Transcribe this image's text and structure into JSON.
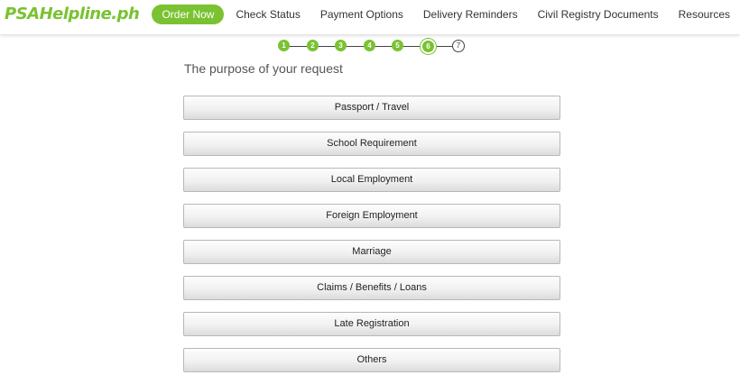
{
  "brand": {
    "logo_text": "PSAHelpline.ph",
    "accent_color": "#7ac231"
  },
  "nav": {
    "items": [
      {
        "label": "Order Now",
        "primary": true
      },
      {
        "label": "Check Status"
      },
      {
        "label": "Payment Options"
      },
      {
        "label": "Delivery Reminders"
      },
      {
        "label": "Civil Registry Documents"
      },
      {
        "label": "Resources"
      }
    ]
  },
  "stepper": {
    "current_step": 6,
    "steps": [
      "1",
      "2",
      "3",
      "4",
      "5",
      "6",
      "7"
    ]
  },
  "page": {
    "title": "The purpose of your request"
  },
  "options": [
    "Passport / Travel",
    "School Requirement",
    "Local Employment",
    "Foreign Employment",
    "Marriage",
    "Claims / Benefits / Loans",
    "Late Registration",
    "Others"
  ]
}
